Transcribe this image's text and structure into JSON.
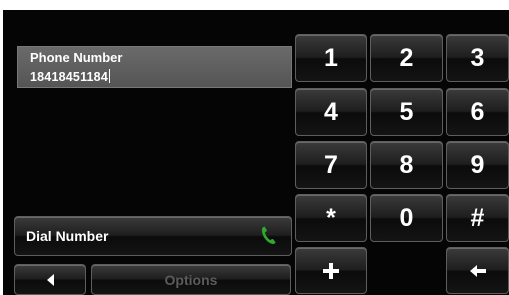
{
  "phone_field": {
    "label": "Phone Number",
    "value": "18418451184"
  },
  "keypad": {
    "keys": [
      "1",
      "2",
      "3",
      "4",
      "5",
      "6",
      "7",
      "8",
      "9",
      "*",
      "0",
      "#"
    ],
    "plus_icon": "plus-icon",
    "backspace_icon": "backspace-arrow-icon"
  },
  "dial_button": {
    "label": "Dial Number",
    "icon": "phone-handset-icon",
    "icon_color": "#2fa82f"
  },
  "bottom_bar": {
    "back_icon": "back-triangle-icon",
    "options_label": "Options"
  },
  "colors": {
    "background": "#050505",
    "field": "#606060",
    "key_text": "#ffffff",
    "disabled_text": "#5b5b5b"
  }
}
